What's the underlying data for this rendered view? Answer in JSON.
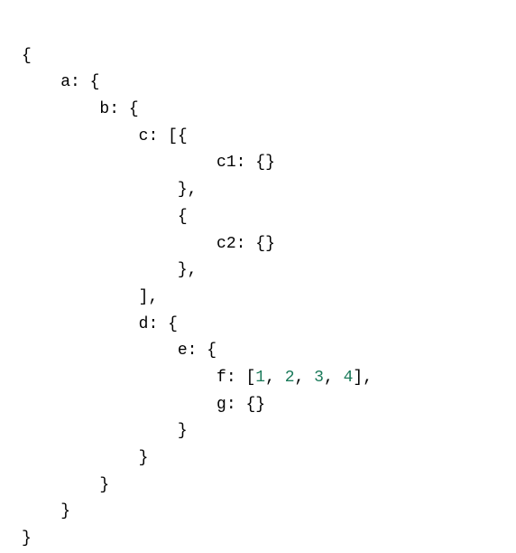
{
  "code": {
    "open_brace": "{",
    "close_brace": "}",
    "open_bracket": "[",
    "close_bracket": "]",
    "colon": ":",
    "comma": ",",
    "empty_obj": "{}",
    "keys": {
      "a": "a",
      "b": "b",
      "c": "c",
      "c1": "c1",
      "c2": "c2",
      "d": "d",
      "e": "e",
      "f": "f",
      "g": "g"
    },
    "numbers": {
      "n1": "1",
      "n2": "2",
      "n3": "3",
      "n4": "4"
    },
    "indent1": "    ",
    "indent2": "        ",
    "indent3": "            ",
    "indent4": "                ",
    "indent5": "                    ",
    "indent6": "                        ",
    "space": " "
  }
}
